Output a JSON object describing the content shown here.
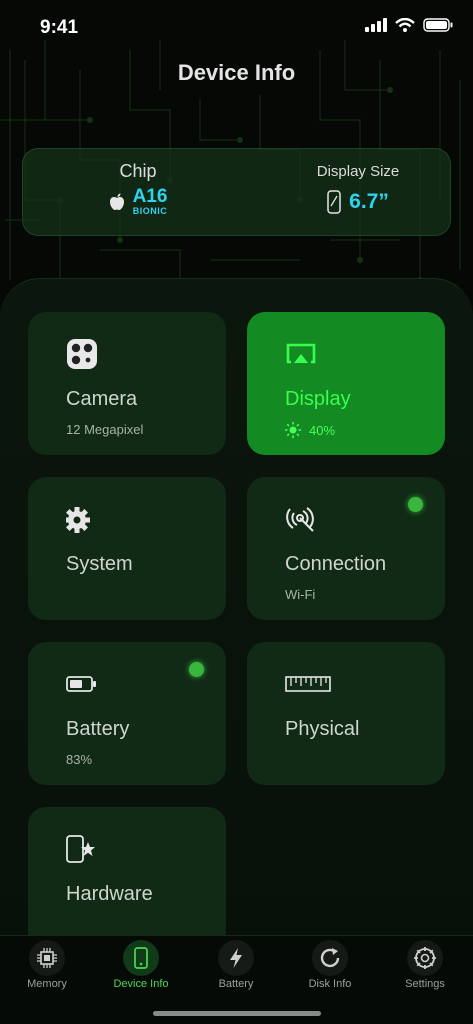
{
  "status_bar": {
    "time": "9:41"
  },
  "page": {
    "title": "Device Info"
  },
  "info_card": {
    "chip_label": "Chip",
    "chip_name": "A16",
    "chip_sub": "BIONIC",
    "display_size_label": "Display Size",
    "display_size_value": "6.7”"
  },
  "tiles": [
    {
      "title": "Camera",
      "subtitle": "12 Megapixel",
      "icon": "camera-icon"
    },
    {
      "title": "Display",
      "subtitle": "40%",
      "icon": "airplay-icon",
      "active": true
    },
    {
      "title": "System",
      "subtitle": "",
      "icon": "gear-icon"
    },
    {
      "title": "Connection",
      "subtitle": "Wi-Fi",
      "icon": "signal-icon",
      "indicator": true
    },
    {
      "title": "Battery",
      "subtitle": "83%",
      "icon": "battery-icon",
      "indicator": true
    },
    {
      "title": "Physical",
      "subtitle": "",
      "icon": "ruler-icon"
    },
    {
      "title": "Hardware",
      "subtitle": "",
      "icon": "phone-star-icon"
    }
  ],
  "tab_bar": {
    "tabs": [
      {
        "label": "Memory",
        "icon": "chip-icon"
      },
      {
        "label": "Device Info",
        "icon": "phone-icon",
        "active": true
      },
      {
        "label": "Battery",
        "icon": "bolt-icon"
      },
      {
        "label": "Disk Info",
        "icon": "disk-icon"
      },
      {
        "label": "Settings",
        "icon": "settings-icon"
      }
    ]
  },
  "colors": {
    "accent": "#37ff4e",
    "cyan": "#2fd3ee",
    "tile": "#112a16",
    "tile_active": "#138a22"
  }
}
